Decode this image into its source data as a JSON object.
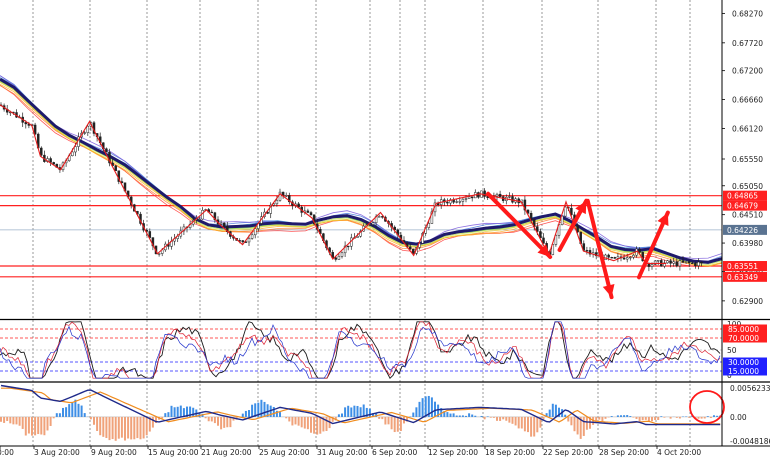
{
  "chart_data": [
    {
      "type": "line",
      "panel": "price",
      "ylim": [
        0.6258,
        0.6852
      ],
      "y_ticks": [
        "0.68270",
        "0.67720",
        "0.67200",
        "0.66660",
        "0.66120",
        "0.65550",
        "0.65050",
        "0.64510",
        "0.63980",
        "0.63450",
        "0.62900"
      ],
      "x_ticks": [
        "0:00",
        "3 Aug 20:00",
        "9 Aug 20:00",
        "15 Aug 20:00",
        "21 Aug 20:00",
        "25 Aug 20:00",
        "31 Aug 20:00",
        "6 Sep 20:00",
        "12 Sep 20:00",
        "18 Sep 20:00",
        "22 Sep 20:00",
        "28 Sep 20:00",
        "4 Oct 20:00"
      ],
      "price_labels": [
        {
          "text": "0.64865",
          "value": 0.64865,
          "color": "#ff2020"
        },
        {
          "text": "0.64679",
          "value": 0.64679,
          "color": "#ff2020"
        },
        {
          "text": "0.64226",
          "value": 0.64226,
          "color": "#5a7391"
        },
        {
          "text": "0.63551",
          "value": 0.63551,
          "color": "#ff2020"
        },
        {
          "text": "0.63349",
          "value": 0.63349,
          "color": "#ff2020"
        }
      ],
      "levels": [
        0.64865,
        0.64679,
        0.63551,
        0.63349
      ],
      "ma_base": [
        0.67,
        0.6685,
        0.666,
        0.6636,
        0.6612,
        0.6595,
        0.6582,
        0.6568,
        0.6555,
        0.654,
        0.652,
        0.65,
        0.648,
        0.6462,
        0.644,
        0.6428,
        0.6424,
        0.6425,
        0.6426,
        0.643,
        0.6432,
        0.643,
        0.6429,
        0.6437,
        0.6443,
        0.6445,
        0.6438,
        0.6425,
        0.6408,
        0.6395,
        0.6392,
        0.6398,
        0.641,
        0.6415,
        0.6418,
        0.6422,
        0.6424,
        0.6428,
        0.6436,
        0.6443,
        0.6448,
        0.6436,
        0.642,
        0.6405,
        0.6388,
        0.6382,
        0.638,
        0.6384,
        0.6375,
        0.6366,
        0.636,
        0.6358,
        0.6365
      ],
      "zigzag": [
        [
          0.0,
          0.6656
        ],
        [
          0.044,
          0.6618
        ],
        [
          0.056,
          0.656
        ],
        [
          0.084,
          0.6535
        ],
        [
          0.124,
          0.6625
        ],
        [
          0.158,
          0.6535
        ],
        [
          0.218,
          0.6378
        ],
        [
          0.286,
          0.646
        ],
        [
          0.305,
          0.6432
        ],
        [
          0.336,
          0.6395
        ],
        [
          0.388,
          0.649
        ],
        [
          0.432,
          0.6445
        ],
        [
          0.461,
          0.6368
        ],
        [
          0.527,
          0.6455
        ],
        [
          0.573,
          0.6375
        ],
        [
          0.604,
          0.6472
        ],
        [
          0.665,
          0.649
        ],
        [
          0.722,
          0.6475
        ],
        [
          0.76,
          0.6375
        ],
        [
          0.784,
          0.6475
        ],
        [
          0.808,
          0.6383
        ],
        [
          0.85,
          0.6365
        ],
        [
          0.883,
          0.6383
        ],
        [
          0.895,
          0.636
        ],
        [
          0.923,
          0.636
        ]
      ],
      "arrows": [
        {
          "from": [
            0.676,
            0.649
          ],
          "to": [
            0.762,
            0.6372
          ]
        },
        {
          "from": [
            0.775,
            0.6385
          ],
          "to": [
            0.812,
            0.6477
          ]
        },
        {
          "from": [
            0.814,
            0.6477
          ],
          "to": [
            0.847,
            0.6297
          ]
        },
        {
          "from": [
            0.885,
            0.6334
          ],
          "to": [
            0.925,
            0.6455
          ]
        }
      ]
    },
    {
      "type": "line",
      "panel": "oscillator",
      "ylim": [
        0,
        100
      ],
      "y_ticks": [
        "100",
        "50",
        "0"
      ],
      "level_labels": [
        {
          "text": "85.0000",
          "value": 85,
          "color": "#ff2020"
        },
        {
          "text": "70.0000",
          "value": 70,
          "color": "#ff2020"
        },
        {
          "text": "30.0000",
          "value": 30,
          "color": "#2020ff"
        },
        {
          "text": "15.0000",
          "value": 15,
          "color": "#2020ff"
        }
      ]
    },
    {
      "type": "bar",
      "panel": "macd",
      "ylim": [
        -0.0048186,
        0.0056233
      ],
      "y_ticks": [
        "0.0056233",
        "0.00",
        "-0.0048186"
      ],
      "zero": 0.0
    }
  ]
}
